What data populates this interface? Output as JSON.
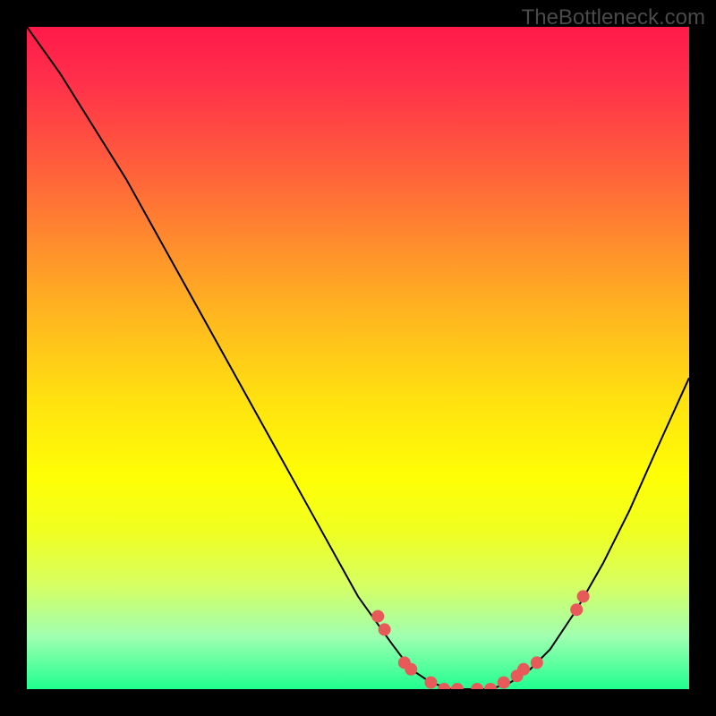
{
  "watermark": "TheBottleneck.com",
  "chart_data": {
    "type": "line",
    "title": "",
    "xlabel": "",
    "ylabel": "",
    "xlim": [
      0,
      100
    ],
    "ylim": [
      0,
      100
    ],
    "curve": [
      {
        "x": 0,
        "y": 100
      },
      {
        "x": 5,
        "y": 93
      },
      {
        "x": 10,
        "y": 85
      },
      {
        "x": 15,
        "y": 77
      },
      {
        "x": 20,
        "y": 68
      },
      {
        "x": 25,
        "y": 59
      },
      {
        "x": 30,
        "y": 50
      },
      {
        "x": 35,
        "y": 41
      },
      {
        "x": 40,
        "y": 32
      },
      {
        "x": 45,
        "y": 23
      },
      {
        "x": 50,
        "y": 14
      },
      {
        "x": 55,
        "y": 7
      },
      {
        "x": 58,
        "y": 3
      },
      {
        "x": 61,
        "y": 1
      },
      {
        "x": 64,
        "y": 0
      },
      {
        "x": 67,
        "y": 0
      },
      {
        "x": 70,
        "y": 0
      },
      {
        "x": 73,
        "y": 1
      },
      {
        "x": 76,
        "y": 3
      },
      {
        "x": 79,
        "y": 6
      },
      {
        "x": 83,
        "y": 12
      },
      {
        "x": 87,
        "y": 19
      },
      {
        "x": 91,
        "y": 27
      },
      {
        "x": 95,
        "y": 36
      },
      {
        "x": 100,
        "y": 47
      }
    ],
    "highlight_points": [
      {
        "x": 53,
        "y": 11
      },
      {
        "x": 54,
        "y": 9
      },
      {
        "x": 57,
        "y": 4
      },
      {
        "x": 58,
        "y": 3
      },
      {
        "x": 61,
        "y": 1
      },
      {
        "x": 63,
        "y": 0
      },
      {
        "x": 65,
        "y": 0
      },
      {
        "x": 68,
        "y": 0
      },
      {
        "x": 70,
        "y": 0
      },
      {
        "x": 72,
        "y": 1
      },
      {
        "x": 74,
        "y": 2
      },
      {
        "x": 75,
        "y": 3
      },
      {
        "x": 77,
        "y": 4
      },
      {
        "x": 83,
        "y": 12
      },
      {
        "x": 84,
        "y": 14
      }
    ]
  }
}
